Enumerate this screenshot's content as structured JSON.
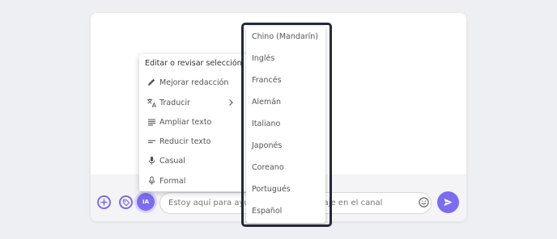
{
  "composer": {
    "ia_label": "IA",
    "input_value": "Estoy aquí para ayudarte con tu mensaje en el canal",
    "placeholder": ""
  },
  "menu": {
    "title": "Editar o revisar selección",
    "items": [
      {
        "label": "Mejorar redacción",
        "icon": "pencil-icon"
      },
      {
        "label": "Traducir",
        "icon": "translate-icon"
      },
      {
        "label": "Ampliar texto",
        "icon": "expand-text-icon"
      },
      {
        "label": "Reducir texto",
        "icon": "shorten-text-icon"
      },
      {
        "label": "Casual",
        "icon": "microphone-icon"
      },
      {
        "label": "Formal",
        "icon": "microphone-icon"
      }
    ]
  },
  "languages": [
    "Chino (Mandarín)",
    "Inglés",
    "Francés",
    "Alemán",
    "Italiano",
    "Japonés",
    "Coreano",
    "Portugués",
    "Español"
  ],
  "colors": {
    "accent": "#7b6cf2",
    "highlight_border": "#252838"
  }
}
